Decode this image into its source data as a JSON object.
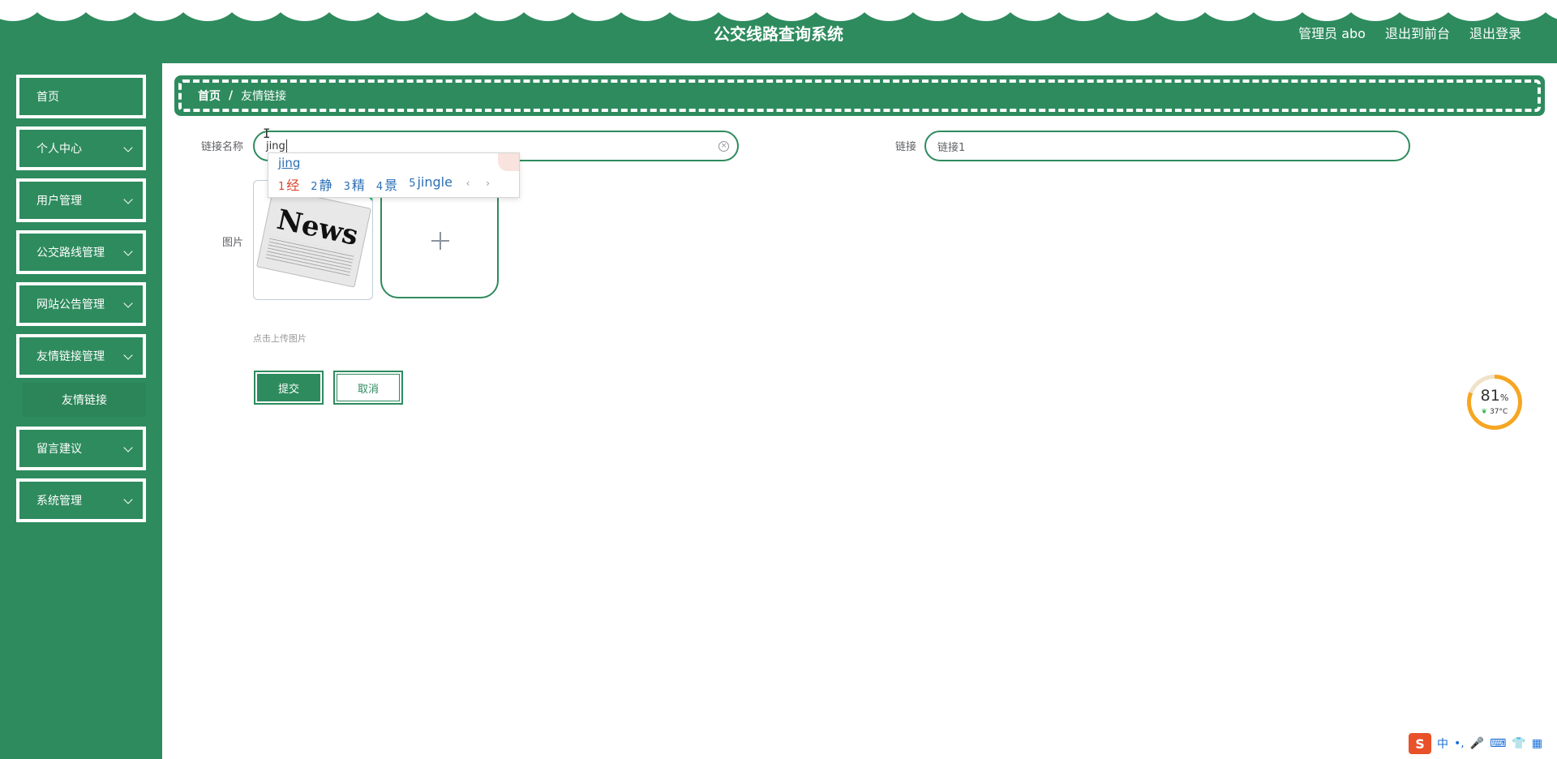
{
  "header": {
    "title": "公交线路查询系统",
    "admin_label": "管理员 abo",
    "front_link": "退出到前台",
    "logout_link": "退出登录"
  },
  "sidebar": {
    "items": [
      {
        "label": "首页"
      },
      {
        "label": "个人中心"
      },
      {
        "label": "用户管理"
      },
      {
        "label": "公交路线管理"
      },
      {
        "label": "网站公告管理"
      },
      {
        "label": "友情链接管理"
      },
      {
        "label": "留言建议"
      },
      {
        "label": "系统管理"
      }
    ],
    "sub_item": "友情链接"
  },
  "breadcrumb": {
    "home": "首页",
    "separator": "/",
    "current": "友情链接"
  },
  "form": {
    "name_label": "链接名称",
    "name_value": "jing",
    "link_label": "链接",
    "link_value": "链接1",
    "image_label": "图片",
    "thumb_text": "News",
    "upload_hint": "点击上传图片",
    "submit_label": "提交",
    "cancel_label": "取消"
  },
  "ime_popup": {
    "composition": "jing",
    "candidates": [
      {
        "num": "1",
        "text": "经"
      },
      {
        "num": "2",
        "text": "静"
      },
      {
        "num": "3",
        "text": "精"
      },
      {
        "num": "4",
        "text": "景"
      },
      {
        "num": "5",
        "text": "jingle"
      }
    ],
    "nav": "‹ ›"
  },
  "system_gauge": {
    "percent": "81",
    "percent_unit": "%",
    "temperature": "37°C"
  },
  "ime_toolbar": {
    "logo": "S",
    "mode": "中",
    "punct": "•,",
    "mic": "🎤",
    "keyboard": "⌨",
    "skin": "👕",
    "apps": "▦"
  },
  "colors": {
    "primary": "#2e8b5e",
    "accent_orange": "#f5a623",
    "candidate_blue": "#2a6fb5",
    "candidate_red": "#d9462b"
  }
}
